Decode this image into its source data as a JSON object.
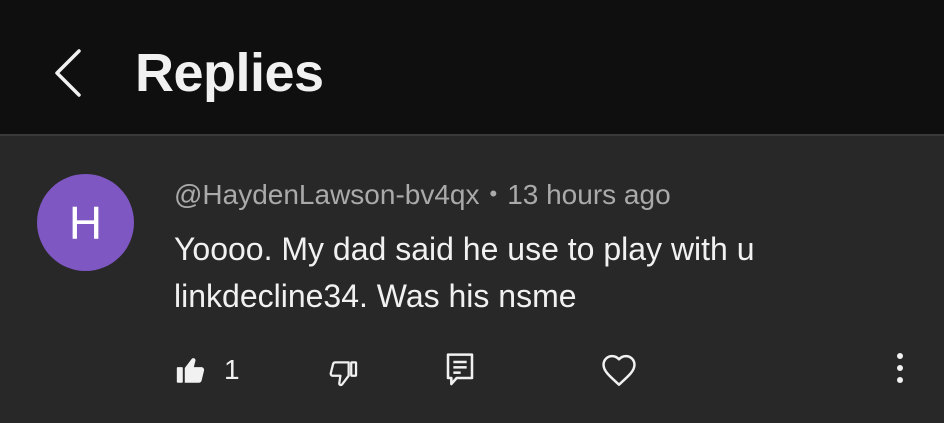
{
  "header": {
    "title": "Replies",
    "back_icon": "chevron-left-icon"
  },
  "comment": {
    "avatar_letter": "H",
    "avatar_color": "#7e57c2",
    "author": "@HaydenLawson-bv4qx",
    "separator": "•",
    "time": "13 hours ago",
    "text": "Yoooo.  My dad said he use to play with u linkdecline34. Was his nsme",
    "actions": {
      "like_count": "1",
      "like_icon": "thumbs-up-icon",
      "dislike_icon": "thumbs-down-icon",
      "reply_icon": "comment-icon",
      "heart_icon": "heart-icon",
      "more_icon": "more-vertical-icon"
    }
  }
}
